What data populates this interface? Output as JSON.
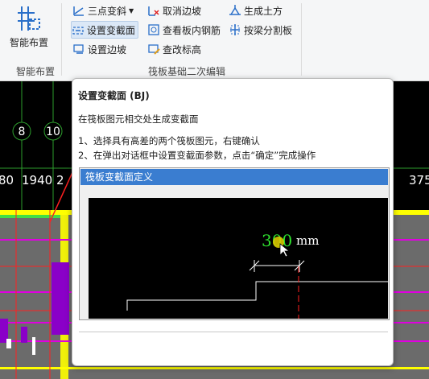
{
  "ribbon": {
    "smart_layout_label": "智能布置",
    "smart_layout_group": "智能布置",
    "items": {
      "three_point_slope": "三点变斜",
      "cancel_slope": "取消边坡",
      "generate_earthwork": "生成土方",
      "set_section": "设置变截面",
      "view_rebar": "查看板内钢筋",
      "split_by_beam": "按梁分割板",
      "set_slope": "设置边坡",
      "change_elevation": "查改标高"
    },
    "group_label": "筏板基础二次编辑"
  },
  "canvas": {
    "axis_labels": [
      "8",
      "10"
    ],
    "dimensions": [
      "80",
      "1940",
      "2",
      "375"
    ]
  },
  "tooltip": {
    "title": "设置变截面 (BJ)",
    "description": "在筏板图元相交处生成变截面",
    "step1": "1、选择具有高差的两个筏板图元，右键确认",
    "step2": "2、在弹出对话框中设置变截面参数，点击“确定”完成操作",
    "preview": {
      "window_title": "筏板变截面定义",
      "value": "300",
      "unit": "mm"
    }
  },
  "colors": {
    "accent": "#3a7dd0",
    "dimension_green": "#1fd11f",
    "slab_yellow": "#ffff00",
    "wall_magenta": "#e000e0",
    "red_line": "#ff2020"
  }
}
